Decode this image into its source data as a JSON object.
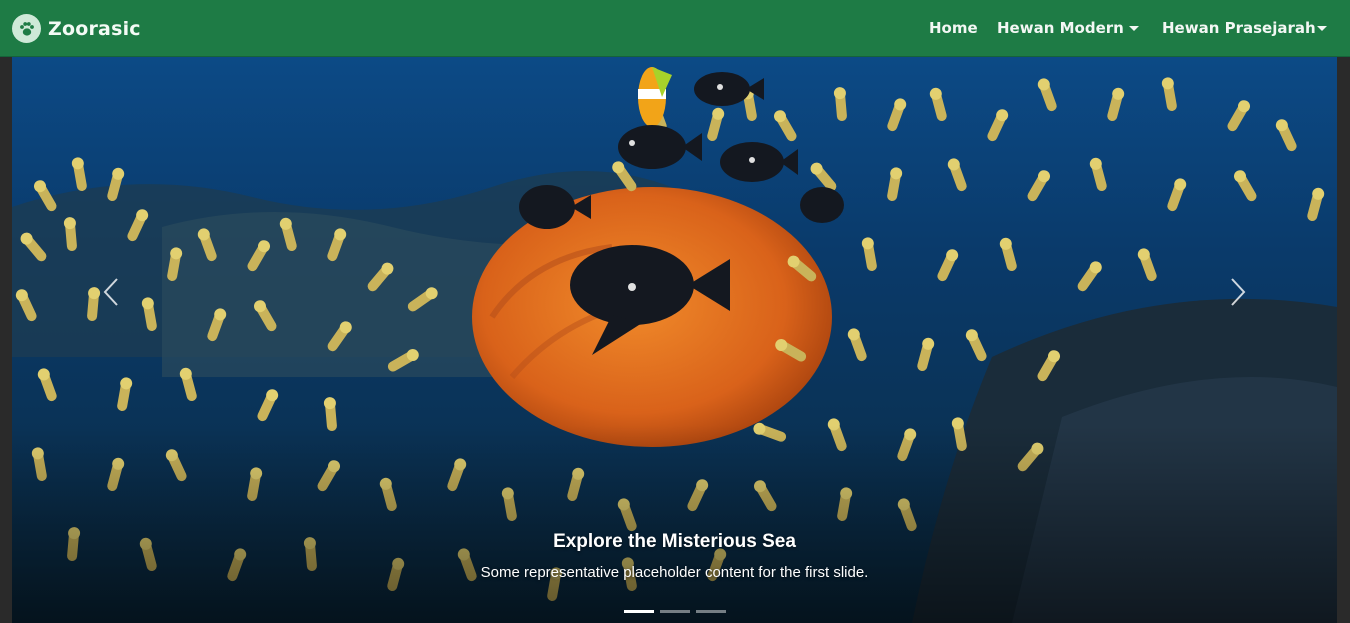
{
  "navbar": {
    "brand_name": "Zoorasic",
    "logo_icon": "paw-icon",
    "items": [
      {
        "label": "Home",
        "dropdown": false
      },
      {
        "label": "Hewan Modern",
        "dropdown": true
      },
      {
        "label": "Hewan Prasejarah",
        "dropdown": true
      }
    ],
    "background": "#1e7b45"
  },
  "carousel": {
    "caption_title": "Explore the Misterious Sea",
    "caption_text": "Some representative placeholder content for the first slide.",
    "prev_icon": "chevron-left-icon",
    "next_icon": "chevron-right-icon",
    "slide_count": 3,
    "active_slide": 1
  }
}
